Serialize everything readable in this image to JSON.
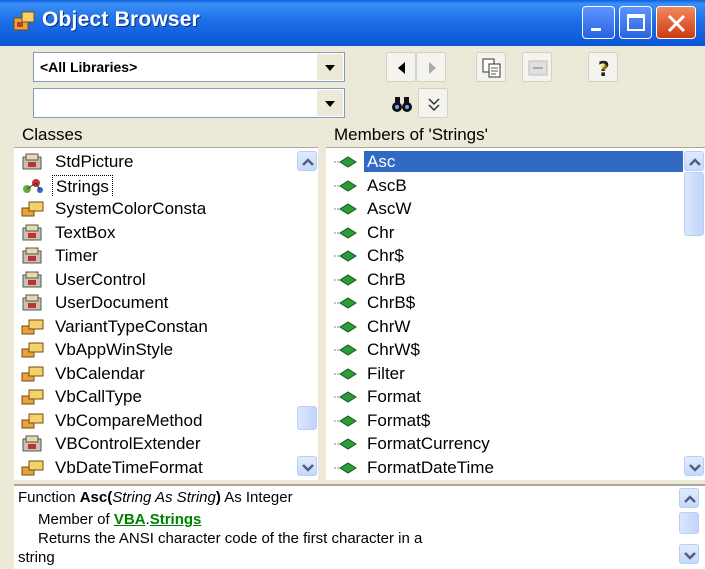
{
  "window": {
    "title": "Object Browser"
  },
  "toolbar": {
    "library_combo_value": "<All Libraries>",
    "search_combo_value": ""
  },
  "classes": {
    "header": "Classes",
    "items": [
      {
        "label": "StdPicture",
        "icon": "class-icon"
      },
      {
        "label": "Strings",
        "icon": "module-icon"
      },
      {
        "label": "SystemColorConsta",
        "icon": "enum-icon"
      },
      {
        "label": "TextBox",
        "icon": "class-icon"
      },
      {
        "label": "Timer",
        "icon": "class-icon"
      },
      {
        "label": "UserControl",
        "icon": "class-icon"
      },
      {
        "label": "UserDocument",
        "icon": "class-icon"
      },
      {
        "label": "VariantTypeConstan",
        "icon": "enum-icon"
      },
      {
        "label": "VbAppWinStyle",
        "icon": "enum-icon"
      },
      {
        "label": "VbCalendar",
        "icon": "enum-icon"
      },
      {
        "label": "VbCallType",
        "icon": "enum-icon"
      },
      {
        "label": "VbCompareMethod",
        "icon": "enum-icon"
      },
      {
        "label": "VBControlExtender",
        "icon": "class-icon"
      },
      {
        "label": "VbDateTimeFormat",
        "icon": "enum-icon"
      }
    ]
  },
  "members": {
    "header": "Members of 'Strings'",
    "items": [
      {
        "label": "Asc"
      },
      {
        "label": "AscB"
      },
      {
        "label": "AscW"
      },
      {
        "label": "Chr"
      },
      {
        "label": "Chr$"
      },
      {
        "label": "ChrB"
      },
      {
        "label": "ChrB$"
      },
      {
        "label": "ChrW"
      },
      {
        "label": "ChrW$"
      },
      {
        "label": "Filter"
      },
      {
        "label": "Format"
      },
      {
        "label": "Format$"
      },
      {
        "label": "FormatCurrency"
      },
      {
        "label": "FormatDateTime"
      }
    ]
  },
  "description": {
    "prefix": "Function ",
    "name": "Asc(",
    "param": "String As String",
    "close": ")",
    "returns": " As Integer",
    "member_of": "Member of ",
    "lib_link": "VBA",
    "dot": ".",
    "class_link": "Strings",
    "summary_1": "Returns the ANSI character code of the first character in a",
    "summary_2": "string"
  },
  "colors": {
    "titlebar": "#0a56d6",
    "selection": "#316ac5",
    "link": "#008000",
    "face": "#ece9d8"
  }
}
